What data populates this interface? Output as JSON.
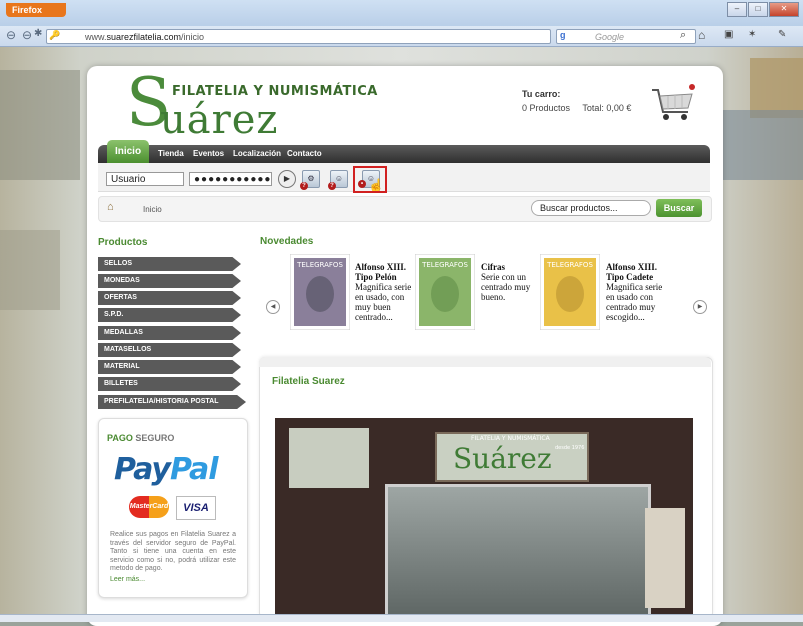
{
  "browser": {
    "app_button": "Firefox",
    "url_prefix": "www.",
    "url_domain": "suarezfilatelia.com",
    "url_path": "/inicio",
    "search_engine": "Google"
  },
  "site": {
    "logo_initial": "S",
    "logo_name": "uárez",
    "tagline": "FILATELIA Y NUMISMÁTICA"
  },
  "cart": {
    "title": "Tu carro:",
    "products": "0 Productos",
    "total": "Total: 0,00 €"
  },
  "menu": {
    "items": [
      "Inicio",
      "Tienda",
      "Eventos",
      "Localización",
      "Contacto"
    ]
  },
  "login": {
    "username_value": "Usuario",
    "password_value": "●●●●●●●●●●●"
  },
  "breadcrumb": {
    "current": "Inicio",
    "search_placeholder": "Buscar productos...",
    "search_button": "Buscar"
  },
  "sidebar": {
    "title": "Productos",
    "categories": [
      "SELLOS",
      "MONEDAS",
      "OFERTAS",
      "S.P.D.",
      "MEDALLAS",
      "MATASELLOS",
      "MATERIAL",
      "BILLETES",
      "PREFILATELIA/HISTORIA POSTAL"
    ]
  },
  "payment": {
    "title_main": "PAGO",
    "title_accent": "SEGURO",
    "paypal_dark": "Pay",
    "paypal_light": "Pal",
    "card1": "MasterCard",
    "card2": "VISA",
    "text": "Realice sus pagos en Filatelia Suarez a través del servidor seguro de PayPal. Tanto si tiene una cuenta en este servicio como si no, podrá utilizar este metodo de pago.",
    "more": "Leer más..."
  },
  "novedades": {
    "title": "Novedades",
    "products": [
      {
        "title": "Alfonso XIII. Tipo Pelón",
        "desc": "Magnifica serie en usado, con muy buen centrado...",
        "stamp_color": "#8a7f9a",
        "stamp_text": "TELEGRAFOS"
      },
      {
        "title": "Cifras",
        "desc": "Serie con un centrado muy bueno.",
        "stamp_color": "#8bb56a",
        "stamp_text": "TELEGRAFOS"
      },
      {
        "title": "Alfonso XIII. Tipo Cadete",
        "desc": "Magnifica serie en usado con centrado muy escogido...",
        "stamp_color": "#e9c148",
        "stamp_text": "TELEGRAFOS"
      }
    ]
  },
  "content": {
    "title": "Filatelia Suarez",
    "photo_sign_small": "FILATELIA Y NUMISMÁTICA",
    "photo_sign_since": "desde 1976",
    "photo_sign_name": "Suárez"
  },
  "colors": {
    "brand_green": "#4a8a31",
    "menu_dark": "#3d3d3d",
    "highlight_red": "#d12020"
  }
}
